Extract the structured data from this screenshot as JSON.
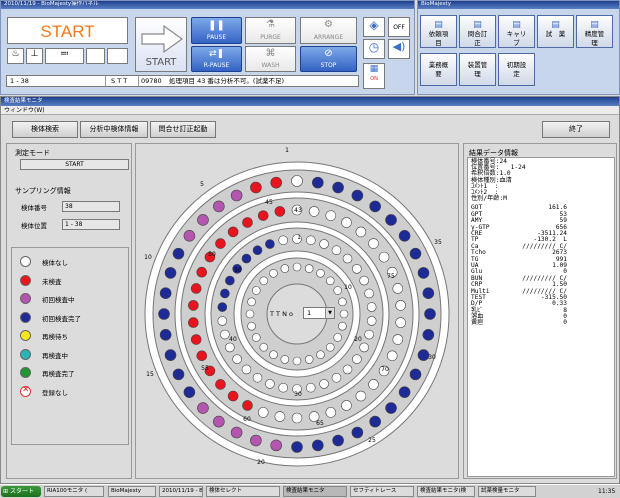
{
  "control_window": {
    "title": "2010/11/19 - BioMajesty操作パネル",
    "start_label": "START",
    "start_button_label": "START",
    "pause_label": "PAUSE",
    "rpause_label": "R-PAUSE",
    "purge_label": "PURGE",
    "wash_label": "WASH",
    "arrange_label": "ARRANGE",
    "stop_label": "STOP",
    "off_label": "OFF",
    "on_label": "ON",
    "status_range": "1 - 38",
    "status_mode": "S T T",
    "status_code": "09780",
    "status_message": "処理項目 43 番は分析不可。(試薬不足)"
  },
  "menu_window": {
    "title": "BioMajesty",
    "buttons_row1": [
      "依頼項目",
      "問合訂正",
      "キャリブ",
      "試　薬",
      "精度管理"
    ],
    "buttons_row2": [
      "業務概要",
      "装置管理",
      "初期設定"
    ]
  },
  "monitor": {
    "title": "検査結果モニタ",
    "menu_label": "ウィンドウ(W)",
    "toolbar": {
      "sample_search": "検体検索",
      "analyzing_info": "分析中検体情報",
      "inquiry_fix": "問合せ訂正起動",
      "exit": "終了"
    },
    "measure_mode_title": "測定モード",
    "measure_mode_value": "START",
    "sampling_title": "サンプリング情報",
    "sample_no_label": "検体番号",
    "sample_no_value": "38",
    "sample_pos_label": "検体位置",
    "sample_pos_value": "1 - 38",
    "legend": [
      {
        "label": "検体なし",
        "color": "#ffffff"
      },
      {
        "label": "未検査",
        "color": "#e8141e"
      },
      {
        "label": "初回検査中",
        "color": "#b455b0"
      },
      {
        "label": "初回検査完了",
        "color": "#1e2a96"
      },
      {
        "label": "再検待ち",
        "color": "#f5e61e"
      },
      {
        "label": "再検査中",
        "color": "#2ab4b4"
      },
      {
        "label": "再検査完了",
        "color": "#1e9632"
      },
      {
        "label": "登録なし",
        "color": "cross"
      }
    ],
    "ttno_label": "T T N o",
    "ttno_value": "1",
    "result_title": "結果データ情報",
    "result_header": [
      "検体番号:24",
      "位置番号:   1-24",
      "希釈倍数:1.0",
      "検体種別:血清",
      "ｺﾒﾝﾄ1  :",
      "ｺﾒﾝﾄ2  :",
      "性別/年齢:M"
    ],
    "result_rows": [
      [
        "GOT",
        "",
        "161.6"
      ],
      [
        "GPT",
        "",
        "53"
      ],
      [
        "AMY",
        "",
        "59"
      ],
      [
        "γ-GTP",
        "",
        "656"
      ],
      [
        "CRE",
        "",
        "-3511.24"
      ],
      [
        "TP",
        "",
        "-130.2  L"
      ],
      [
        "Ca",
        "",
        "///////// C/"
      ],
      [
        "Tcho",
        "",
        "2673"
      ],
      [
        "TG",
        "",
        "991"
      ],
      [
        "UA",
        "",
        "1.09"
      ],
      [
        "Glu",
        "",
        "0"
      ],
      [
        "BUN",
        "",
        "///////// C/"
      ],
      [
        "CRP",
        "",
        "1.50"
      ],
      [
        "Multi",
        "",
        "///////// C/"
      ],
      [
        "TEST",
        "",
        "-315.50"
      ],
      [
        "D/P",
        "",
        "0.33"
      ],
      [
        "乳ﾋﾞ",
        "",
        "8"
      ],
      [
        "溶血",
        "",
        "0"
      ],
      [
        "黄疸",
        "",
        "0"
      ]
    ],
    "rack_labels": {
      "outer": [
        "1",
        "5",
        "10",
        "15",
        "20",
        "25",
        "30",
        "35"
      ],
      "middle": [
        "45",
        "50",
        "55",
        "60",
        "65",
        "70",
        "75"
      ],
      "inner": [
        "43",
        "1",
        "10",
        "20",
        "30",
        "40",
        "50"
      ]
    }
  },
  "taskbar": {
    "start": "スタート",
    "items": [
      "RIA100モニタ (",
      "BioMajesty",
      "2010/11/19 - Bi",
      "検体セレクト",
      "検査結果モニタ",
      "セフティトレース",
      "検査結果モニタ(検",
      "試薬検量モニタ"
    ],
    "clock": "11:35"
  }
}
